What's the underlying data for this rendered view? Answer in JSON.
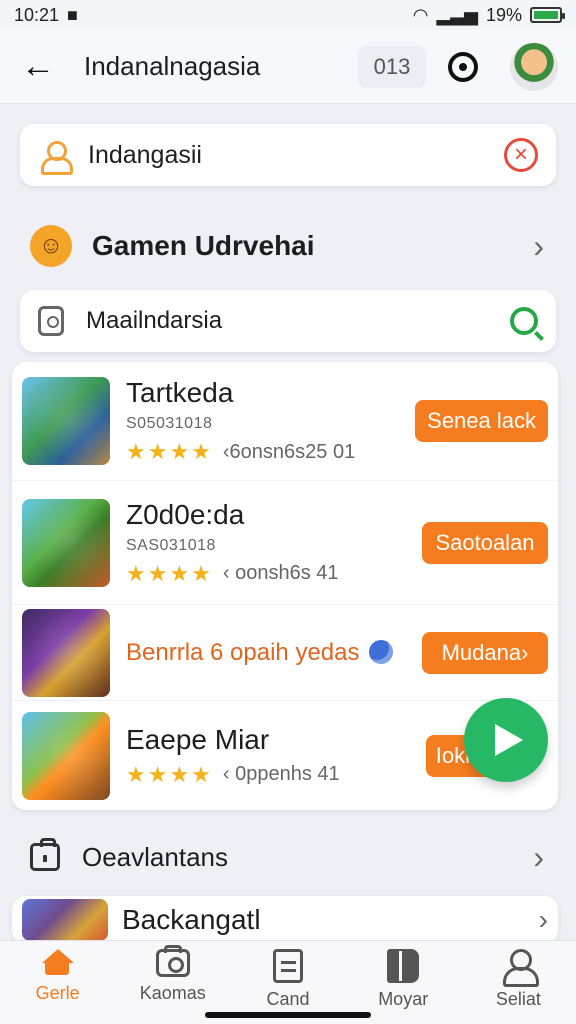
{
  "status": {
    "time": "10:21",
    "battery_text": "19%"
  },
  "appbar": {
    "title": "Indanalnagasia",
    "counter": "013"
  },
  "search": {
    "primary_value": "Indangasii",
    "secondary_value": "Maailndarsia"
  },
  "section": {
    "title": "Gamen Udrvehai"
  },
  "games": [
    {
      "title": "Tartkeda",
      "subtitle": "S05031018",
      "rating_stars": "★★★★",
      "rating_text": "‹6onsn6s25 01",
      "button": "Senea lack"
    },
    {
      "title": "Z0d0e:da",
      "subtitle": "SAS031018",
      "rating_stars": "★★★★",
      "rating_text": "‹ oonsh6s 41",
      "button": "Saotoalan"
    },
    {
      "title": "Benrrla 6 opaih yedas",
      "subtitle": "",
      "rating_stars": "",
      "rating_text": "",
      "button": "Mudana›"
    },
    {
      "title": "Eaepe Miar",
      "subtitle": "",
      "rating_stars": "★★★★",
      "rating_text": "‹ 0ppenhs 41",
      "button": "Iokie"
    }
  ],
  "orders": {
    "label": "Oeavlantans"
  },
  "background_item": {
    "title": "Backangatl"
  },
  "bottom_nav": [
    {
      "label": "Gerle",
      "icon": "home-icon"
    },
    {
      "label": "Kaomas",
      "icon": "camera-icon"
    },
    {
      "label": "Cand",
      "icon": "document-icon"
    },
    {
      "label": "Moyar",
      "icon": "book-icon"
    },
    {
      "label": "Seliat",
      "icon": "user-icon"
    }
  ],
  "colors": {
    "accent": "#f57d1f",
    "success": "#27b865",
    "danger": "#e54b3a",
    "search": "#28a745"
  }
}
